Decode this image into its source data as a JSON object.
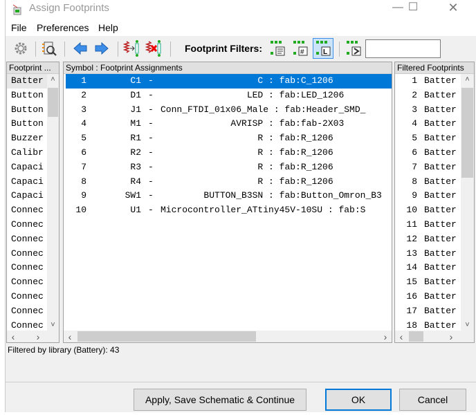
{
  "window": {
    "title": "Assign Footprints",
    "minimize_icon": "minimize-icon",
    "maximize_icon": "maximize-icon",
    "close_icon": "close-icon"
  },
  "menu": [
    "File",
    "Preferences",
    "Help"
  ],
  "toolbar": {
    "filters_label": "Footprint Filters:",
    "filter_input": "",
    "active_filter": "library"
  },
  "left_panel": {
    "header": "Footprint ...",
    "items": [
      "Batter",
      "Button",
      "Button",
      "Button",
      "Buzzer",
      "Calibr",
      "Capaci",
      "Capaci",
      "Capaci",
      "Connec",
      "Connec",
      "Connec",
      "Connec",
      "Connec",
      "Connec",
      "Connec",
      "Connec",
      "Connec"
    ]
  },
  "middle_panel": {
    "header": "Symbol : Footprint Assignments",
    "selected_index": 0,
    "rows": [
      {
        "num": "1",
        "ref": "C1",
        "value": "C",
        "footprint": "fab:C_1206"
      },
      {
        "num": "2",
        "ref": "D1",
        "value": "LED",
        "footprint": "fab:LED_1206"
      },
      {
        "num": "3",
        "ref": "J1",
        "value": "Conn_FTDI_01x06_Male",
        "footprint": "fab:Header_SMD_"
      },
      {
        "num": "4",
        "ref": "M1",
        "value": "AVRISP",
        "footprint": "fab:fab-2X03"
      },
      {
        "num": "5",
        "ref": "R1",
        "value": "R",
        "footprint": "fab:R_1206"
      },
      {
        "num": "6",
        "ref": "R2",
        "value": "R",
        "footprint": "fab:R_1206"
      },
      {
        "num": "7",
        "ref": "R3",
        "value": "R",
        "footprint": "fab:R_1206"
      },
      {
        "num": "8",
        "ref": "R4",
        "value": "R",
        "footprint": "fab:R_1206"
      },
      {
        "num": "9",
        "ref": "SW1",
        "value": "BUTTON_B3SN",
        "footprint": "fab:Button_Omron_B3"
      },
      {
        "num": "10",
        "ref": "U1",
        "value": "Microcontroller_ATtiny45V-10SU",
        "footprint": "fab:S"
      }
    ]
  },
  "right_panel": {
    "header": "Filtered Footprints",
    "items": [
      {
        "num": "1",
        "name": "Batter"
      },
      {
        "num": "2",
        "name": "Batter"
      },
      {
        "num": "3",
        "name": "Batter"
      },
      {
        "num": "4",
        "name": "Batter"
      },
      {
        "num": "5",
        "name": "Batter"
      },
      {
        "num": "6",
        "name": "Batter"
      },
      {
        "num": "7",
        "name": "Batter"
      },
      {
        "num": "8",
        "name": "Batter"
      },
      {
        "num": "9",
        "name": "Batter"
      },
      {
        "num": "10",
        "name": "Batter"
      },
      {
        "num": "11",
        "name": "Batter"
      },
      {
        "num": "12",
        "name": "Batter"
      },
      {
        "num": "13",
        "name": "Batter"
      },
      {
        "num": "14",
        "name": "Batter"
      },
      {
        "num": "15",
        "name": "Batter"
      },
      {
        "num": "16",
        "name": "Batter"
      },
      {
        "num": "17",
        "name": "Batter"
      },
      {
        "num": "18",
        "name": "Batter"
      }
    ]
  },
  "status": "Filtered by library (Battery): 43",
  "buttons": {
    "apply": "Apply, Save Schematic & Continue",
    "ok": "OK",
    "cancel": "Cancel"
  },
  "colors": {
    "selection": "#0078d7",
    "accent_green": "#22a33a",
    "arrow_blue": "#3d8ee8"
  }
}
